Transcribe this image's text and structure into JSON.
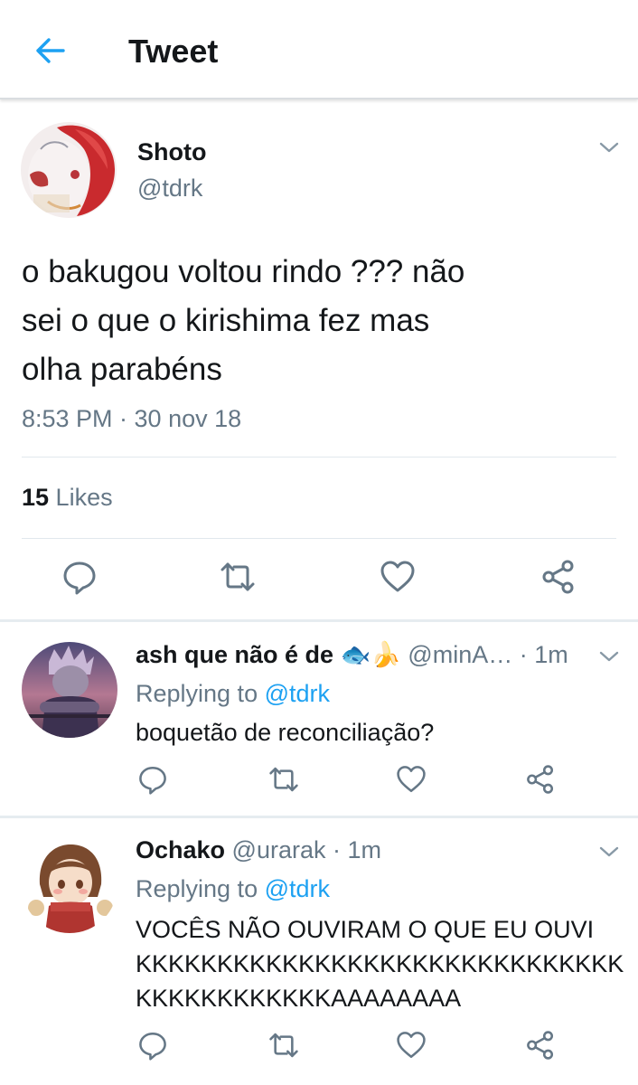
{
  "header": {
    "title": "Tweet"
  },
  "tweet": {
    "name": "Shoto",
    "handle": "@tdrk",
    "text_lines": [
      "o bakugou voltou rindo ??? não",
      "sei o que o kirishima fez mas",
      "olha parabéns"
    ],
    "timestamp": "8:53 PM · 30 nov 18",
    "likes_count": "15",
    "likes_label": " Likes"
  },
  "replies": [
    {
      "name": "ash que não é de 🐟🍌",
      "handle": " @minA…",
      "time": " · 1m",
      "replying_prefix": "Replying to ",
      "replying_mention": "@tdrk",
      "text_lines": [
        "boquetão de reconciliação?"
      ]
    },
    {
      "name": "Ochako",
      "handle": " @urarak",
      "time": " · 1m",
      "replying_prefix": "Replying to ",
      "replying_mention": "@tdrk",
      "text_lines": [
        "VOCÊS NÃO OUVIRAM O QUE EU OUVI",
        "KKKKKKKKKKKKKKKKKKKKKKKKKKKKKK",
        "KKKKKKKKKKKKAAAAAAAA"
      ]
    }
  ],
  "colors": {
    "accent": "#1da1f2",
    "secondary_text": "#657786",
    "divider": "#e1e8ed"
  },
  "icons": [
    "back-arrow-icon",
    "chevron-down-icon",
    "reply-icon",
    "retweet-icon",
    "like-icon",
    "share-icon"
  ]
}
